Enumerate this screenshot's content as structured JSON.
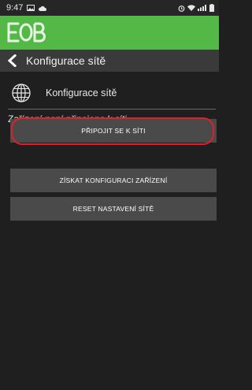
{
  "status_bar": {
    "time": "9:47",
    "icons": [
      "gallery-icon",
      "cloud-icon",
      "alarm-icon",
      "wifi-icon",
      "signal-icon",
      "battery-icon"
    ]
  },
  "header": {
    "logo_name": "eob-logo",
    "title": "Konfigurace sítě"
  },
  "section": {
    "label": "Konfigurace sítě",
    "icon": "globe-icon"
  },
  "status_message": "Zařízení není připojeno k síti",
  "buttons": {
    "connect": "PŘIPOJIT SE K SÍTI",
    "get_config": "ZÍSKAT KONFIGURACI ZAŘÍZENÍ",
    "reset": "RESET NASTAVENÍ SÍTĚ"
  },
  "colors": {
    "app_bar": "#53b846",
    "background": "#1f1f1f",
    "button": "#4a4a4a",
    "highlight": "#e01f2b"
  }
}
